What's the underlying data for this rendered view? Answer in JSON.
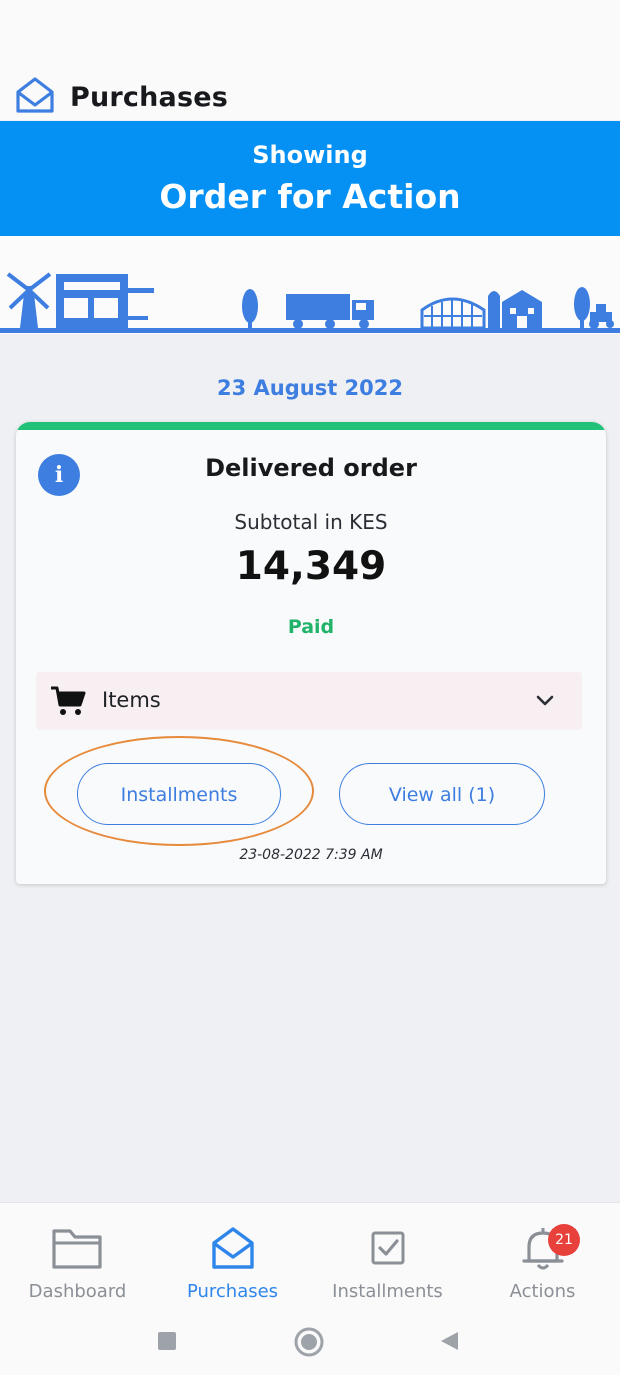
{
  "header": {
    "title": "Purchases",
    "logo_icon": "envelope-open-icon"
  },
  "banner": {
    "subtitle": "Showing",
    "title": "Order for Action",
    "color": "#0590f3"
  },
  "order": {
    "date": "23 August 2022",
    "status_title": "Delivered order",
    "subtotal_label": "Subtotal in KES",
    "amount": "14,349",
    "payment_status": "Paid",
    "items_label": "Items",
    "installments_button": "Installments",
    "view_all_button": "View all (1)",
    "timestamp": "23-08-2022 7:39 AM"
  },
  "bottom_nav": {
    "items": [
      {
        "label": "Dashboard",
        "icon": "folder-icon"
      },
      {
        "label": "Purchases",
        "icon": "envelope-open-icon"
      },
      {
        "label": "Installments",
        "icon": "checkbox-icon"
      },
      {
        "label": "Actions",
        "icon": "bell-icon"
      }
    ],
    "active": "Purchases",
    "actions_badge": "21"
  },
  "colors": {
    "accent": "#3d7ee0",
    "success": "#22c17a",
    "badge": "#e8413c",
    "highlight": "#e68a3c"
  }
}
